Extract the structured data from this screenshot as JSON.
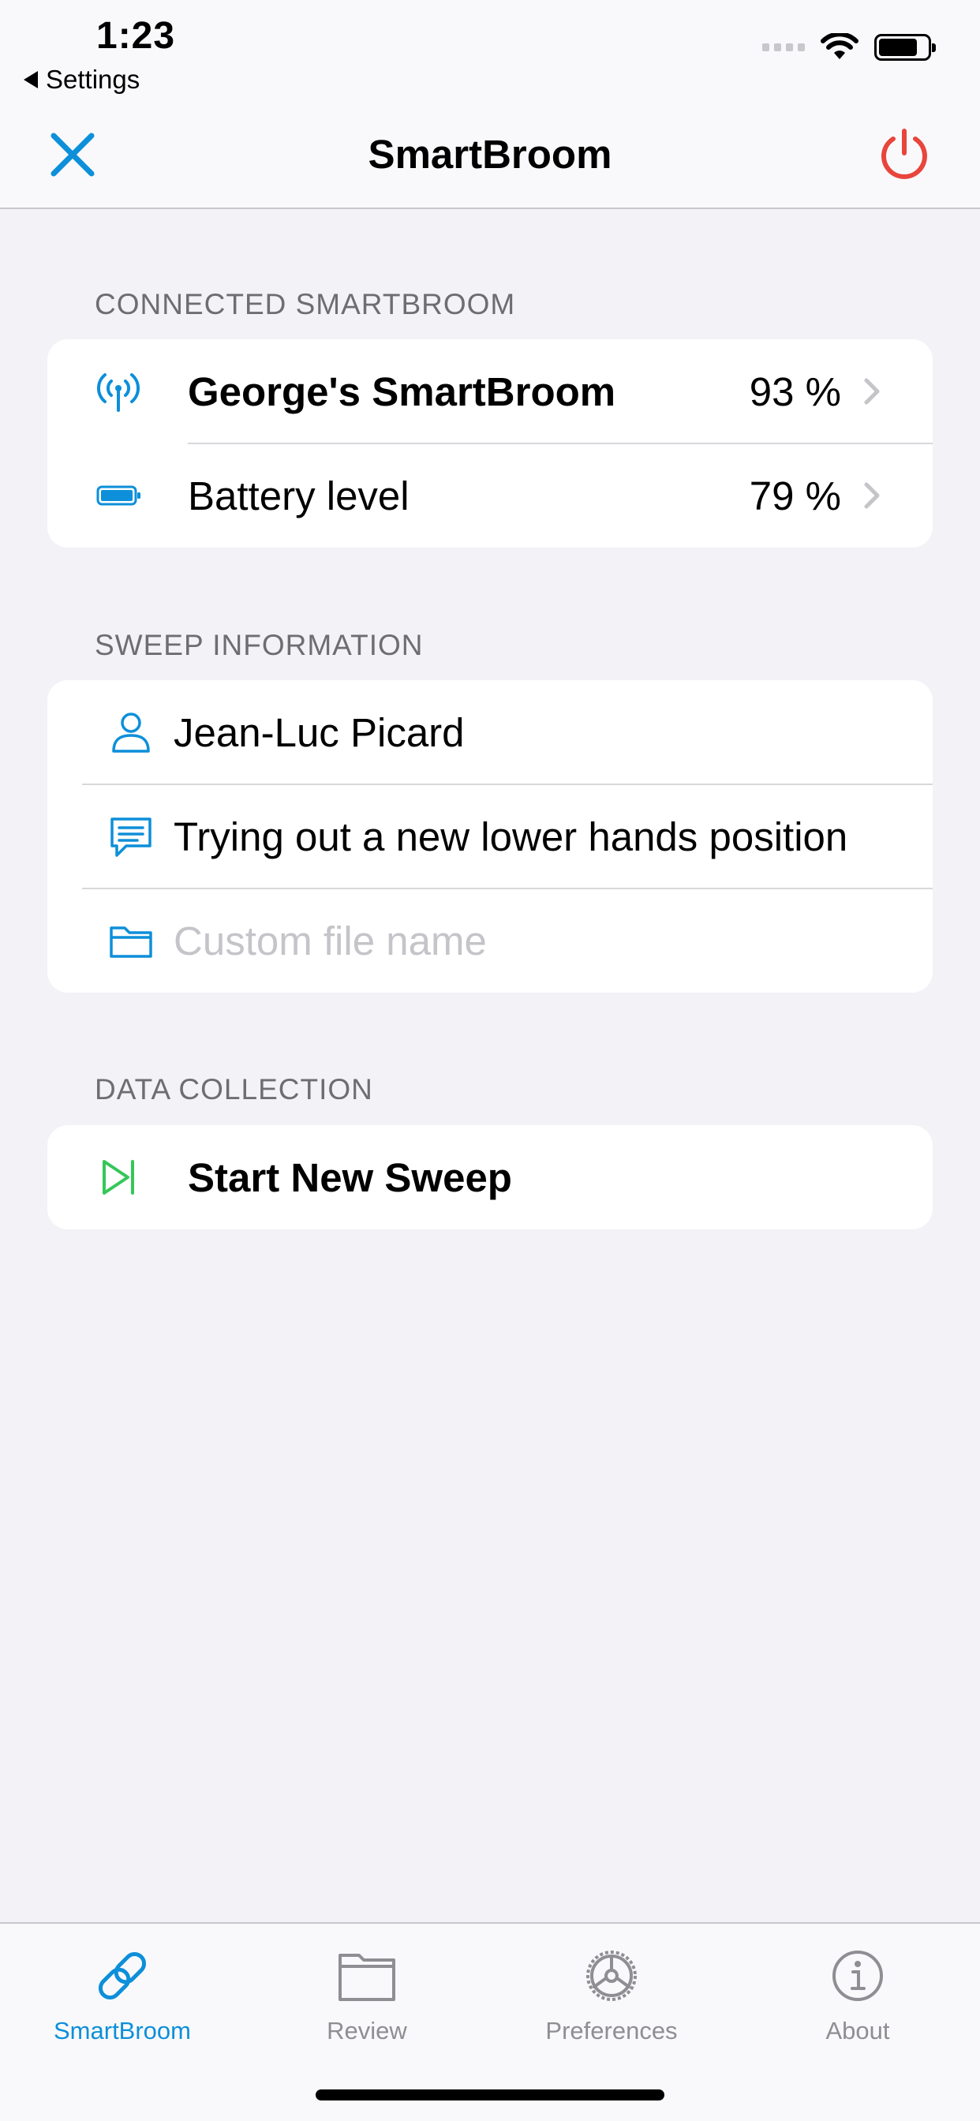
{
  "status_bar": {
    "time": "1:23",
    "back_label": "Settings"
  },
  "nav": {
    "title": "SmartBroom",
    "accent_color": "#0d8fd9",
    "power_color": "#e8453c"
  },
  "connected_section": {
    "header": "CONNECTED SMARTBROOM",
    "rows": [
      {
        "label": "George's SmartBroom",
        "value": "93 %",
        "icon": "antenna-icon"
      },
      {
        "label": "Battery level",
        "value": "79 %",
        "icon": "battery-icon"
      }
    ]
  },
  "sweep_section": {
    "header": "SWEEP INFORMATION",
    "user_name": "Jean-Luc Picard",
    "comment": "Trying out a new lower hands position",
    "file_name_placeholder": "Custom file name"
  },
  "data_section": {
    "header": "DATA COLLECTION",
    "start_label": "Start New Sweep",
    "start_icon_color": "#34c759"
  },
  "tabs": [
    {
      "label": "SmartBroom",
      "icon": "link-icon",
      "active": true
    },
    {
      "label": "Review",
      "icon": "folder-icon",
      "active": false
    },
    {
      "label": "Preferences",
      "icon": "gear-icon",
      "active": false
    },
    {
      "label": "About",
      "icon": "info-icon",
      "active": false
    }
  ]
}
